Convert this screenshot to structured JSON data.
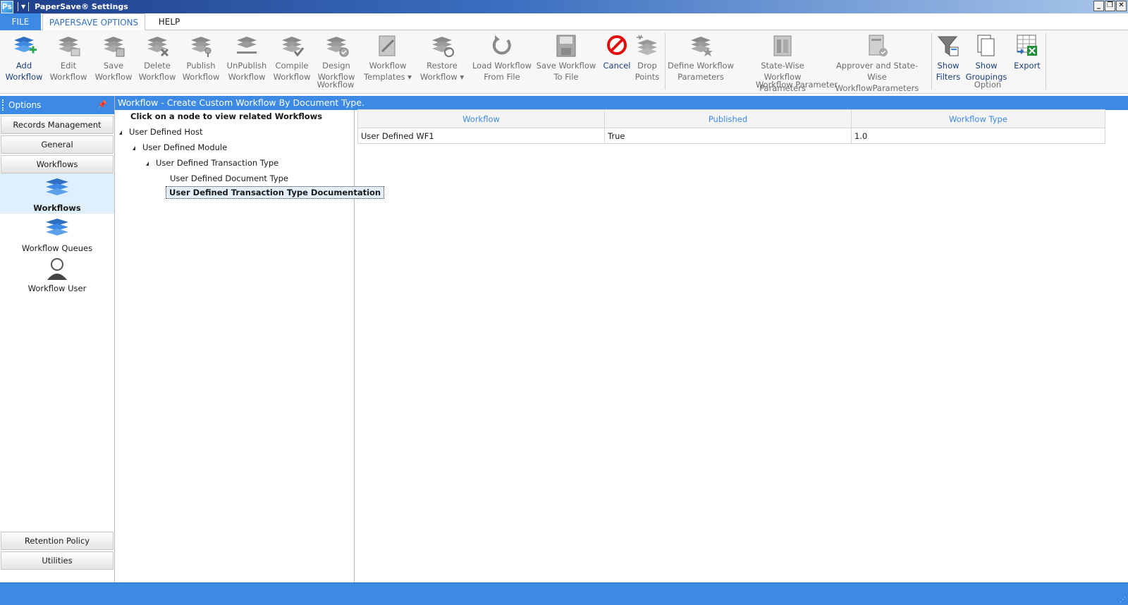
{
  "window": {
    "title": "PaperSave® Settings",
    "app_icon_text": "Ps",
    "buttons": {
      "minimize": "_",
      "restore": "❐",
      "close": "✕"
    }
  },
  "tabs": [
    {
      "label": "FILE"
    },
    {
      "label": "PAPERSAVE OPTIONS"
    },
    {
      "label": "HELP"
    }
  ],
  "ribbon": {
    "workflow_group": {
      "label": "Workflow",
      "buttons": [
        {
          "label1": "Add",
          "label2": "Workflow",
          "icon": "add-workflow-icon",
          "enabled": true
        },
        {
          "label1": "Edit",
          "label2": "Workflow",
          "icon": "edit-workflow-icon",
          "enabled": false
        },
        {
          "label1": "Save",
          "label2": "Workflow",
          "icon": "save-workflow-icon",
          "enabled": false
        },
        {
          "label1": "Delete",
          "label2": "Workflow",
          "icon": "delete-workflow-icon",
          "enabled": false
        },
        {
          "label1": "Publish",
          "label2": "Workflow",
          "icon": "publish-workflow-icon",
          "enabled": false
        },
        {
          "label1": "UnPublish",
          "label2": "Workflow",
          "icon": "unpublish-workflow-icon",
          "enabled": false
        },
        {
          "label1": "Compile",
          "label2": "Workflow",
          "icon": "compile-workflow-icon",
          "enabled": false
        },
        {
          "label1": "Design",
          "label2": "Workflow",
          "icon": "design-workflow-icon",
          "enabled": false
        },
        {
          "label1": "Workflow",
          "label2": "Templates ▾",
          "icon": "workflow-templates-icon",
          "enabled": false
        },
        {
          "label1": "Restore",
          "label2": "Workflow ▾",
          "icon": "restore-workflow-icon",
          "enabled": false
        },
        {
          "label1": "Load Workflow",
          "label2": "From File",
          "icon": "load-workflow-icon",
          "enabled": false
        },
        {
          "label1": "Save Workflow",
          "label2": "To File",
          "icon": "save-to-file-icon",
          "enabled": false
        },
        {
          "label1": "Cancel",
          "label2": "",
          "icon": "cancel-icon",
          "enabled": true
        },
        {
          "label1": "Drop",
          "label2": "Points",
          "icon": "drop-points-icon",
          "enabled": false
        }
      ]
    },
    "parameter_group": {
      "label": "Workflow Parameter",
      "buttons": [
        {
          "label1": "Define Workflow",
          "label2": "Parameters",
          "icon": "define-parameters-icon",
          "enabled": false
        },
        {
          "label1": "State-Wise Workflow",
          "label2": "Parameters",
          "icon": "state-wise-parameters-icon",
          "enabled": false
        },
        {
          "label1": "Approver and State-Wise",
          "label2": "WorkflowParameters",
          "icon": "approver-parameters-icon",
          "enabled": false
        }
      ]
    },
    "option_group": {
      "label": "Option",
      "buttons": [
        {
          "label1": "Show",
          "label2": "Filters",
          "icon": "filter-icon",
          "enabled": true
        },
        {
          "label1": "Show",
          "label2": "Groupings",
          "icon": "groupings-icon",
          "enabled": true
        },
        {
          "label1": "Export",
          "label2": "",
          "icon": "export-excel-icon",
          "enabled": true
        }
      ]
    }
  },
  "left_panel": {
    "header": "Options",
    "pin": "ᵖ",
    "top_buttons": [
      "Records Management",
      "General",
      "Workflows"
    ],
    "items": [
      {
        "label": "Workflows",
        "icon": "workflows-icon",
        "selected": true
      },
      {
        "label": "Workflow Queues",
        "icon": "workflow-queues-icon",
        "selected": false
      },
      {
        "label": "Workflow User",
        "icon": "workflow-user-icon",
        "selected": false
      }
    ],
    "bottom_buttons": [
      "Retention Policy",
      "Utilities"
    ]
  },
  "content": {
    "header": "Workflow - Create Custom Workflow By Document Type.",
    "tree": {
      "hint": "Click on a node to view related Workflows",
      "nodes": [
        {
          "label": "User Defined Host",
          "level": 0,
          "expanded": true
        },
        {
          "label": "User Defined Module",
          "level": 1,
          "expanded": true
        },
        {
          "label": "User Defined Transaction Type",
          "level": 2,
          "expanded": true
        },
        {
          "label": "User Defined Document Type",
          "level": 3,
          "expanded": false
        },
        {
          "label": "User Defined Transaction Type Documentation",
          "level": 3,
          "expanded": false,
          "selected": true
        }
      ]
    },
    "grid": {
      "columns": [
        "Workflow",
        "Published",
        "Workflow Type"
      ],
      "rows": [
        [
          "User Defined WF1",
          "True",
          "1.0"
        ]
      ]
    }
  },
  "colors": {
    "accent": "#3c8ae3",
    "title_bar_start": "#1f3f8a",
    "disabled_text": "#6c6c6c",
    "cancel_red": "#e01010"
  }
}
